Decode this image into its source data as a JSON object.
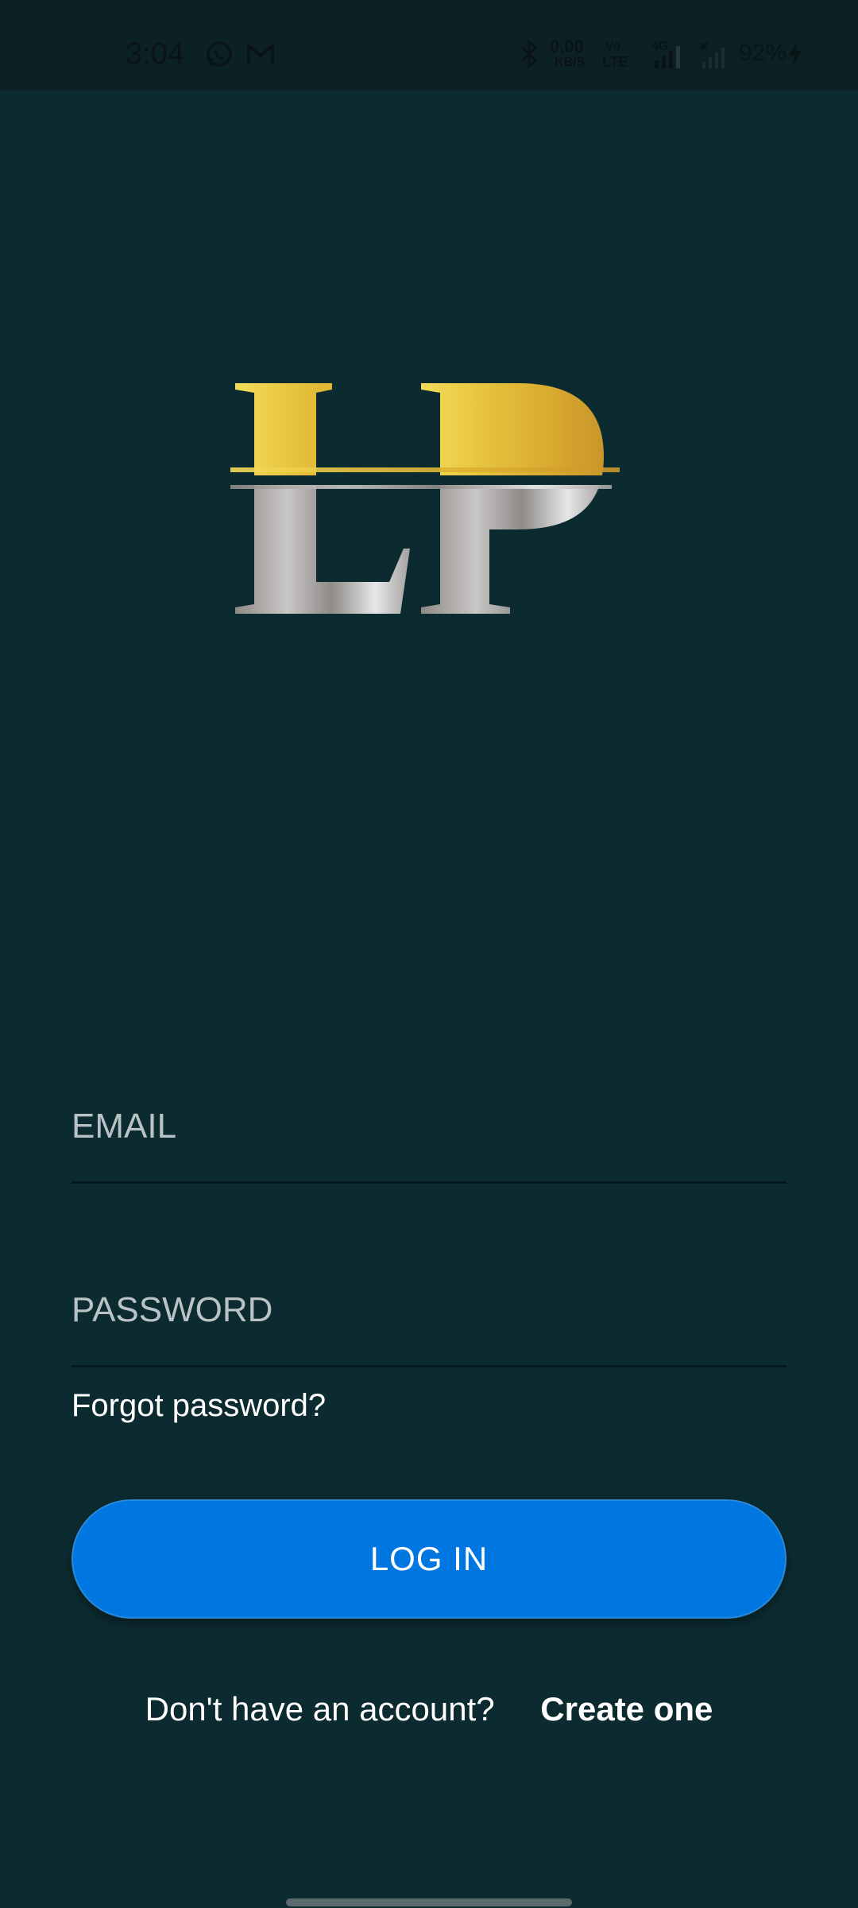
{
  "status_bar": {
    "time": "3:04",
    "net_speed_value": "0.00",
    "net_speed_unit": "KB/S",
    "volte_top": "Vo",
    "volte_bottom": "LTE",
    "network_type": "4G",
    "battery_percent": "92%",
    "icons": [
      "whatsapp-icon",
      "gmail-icon",
      "bluetooth-icon",
      "signal-icon",
      "no-signal-icon",
      "charging-icon"
    ]
  },
  "logo": {
    "text": "LP",
    "gold_color": "#d9b23a",
    "silver_color": "#a9a7a6"
  },
  "form": {
    "email_placeholder": "EMAIL",
    "password_placeholder": "PASSWORD",
    "forgot_label": "Forgot password?",
    "login_label": "LOG IN",
    "signup_prompt": "Don't have an account?",
    "signup_link": "Create one"
  },
  "colors": {
    "background": "#0c2b30",
    "status_bar": "#0b2124",
    "primary_button": "#0077e0"
  }
}
